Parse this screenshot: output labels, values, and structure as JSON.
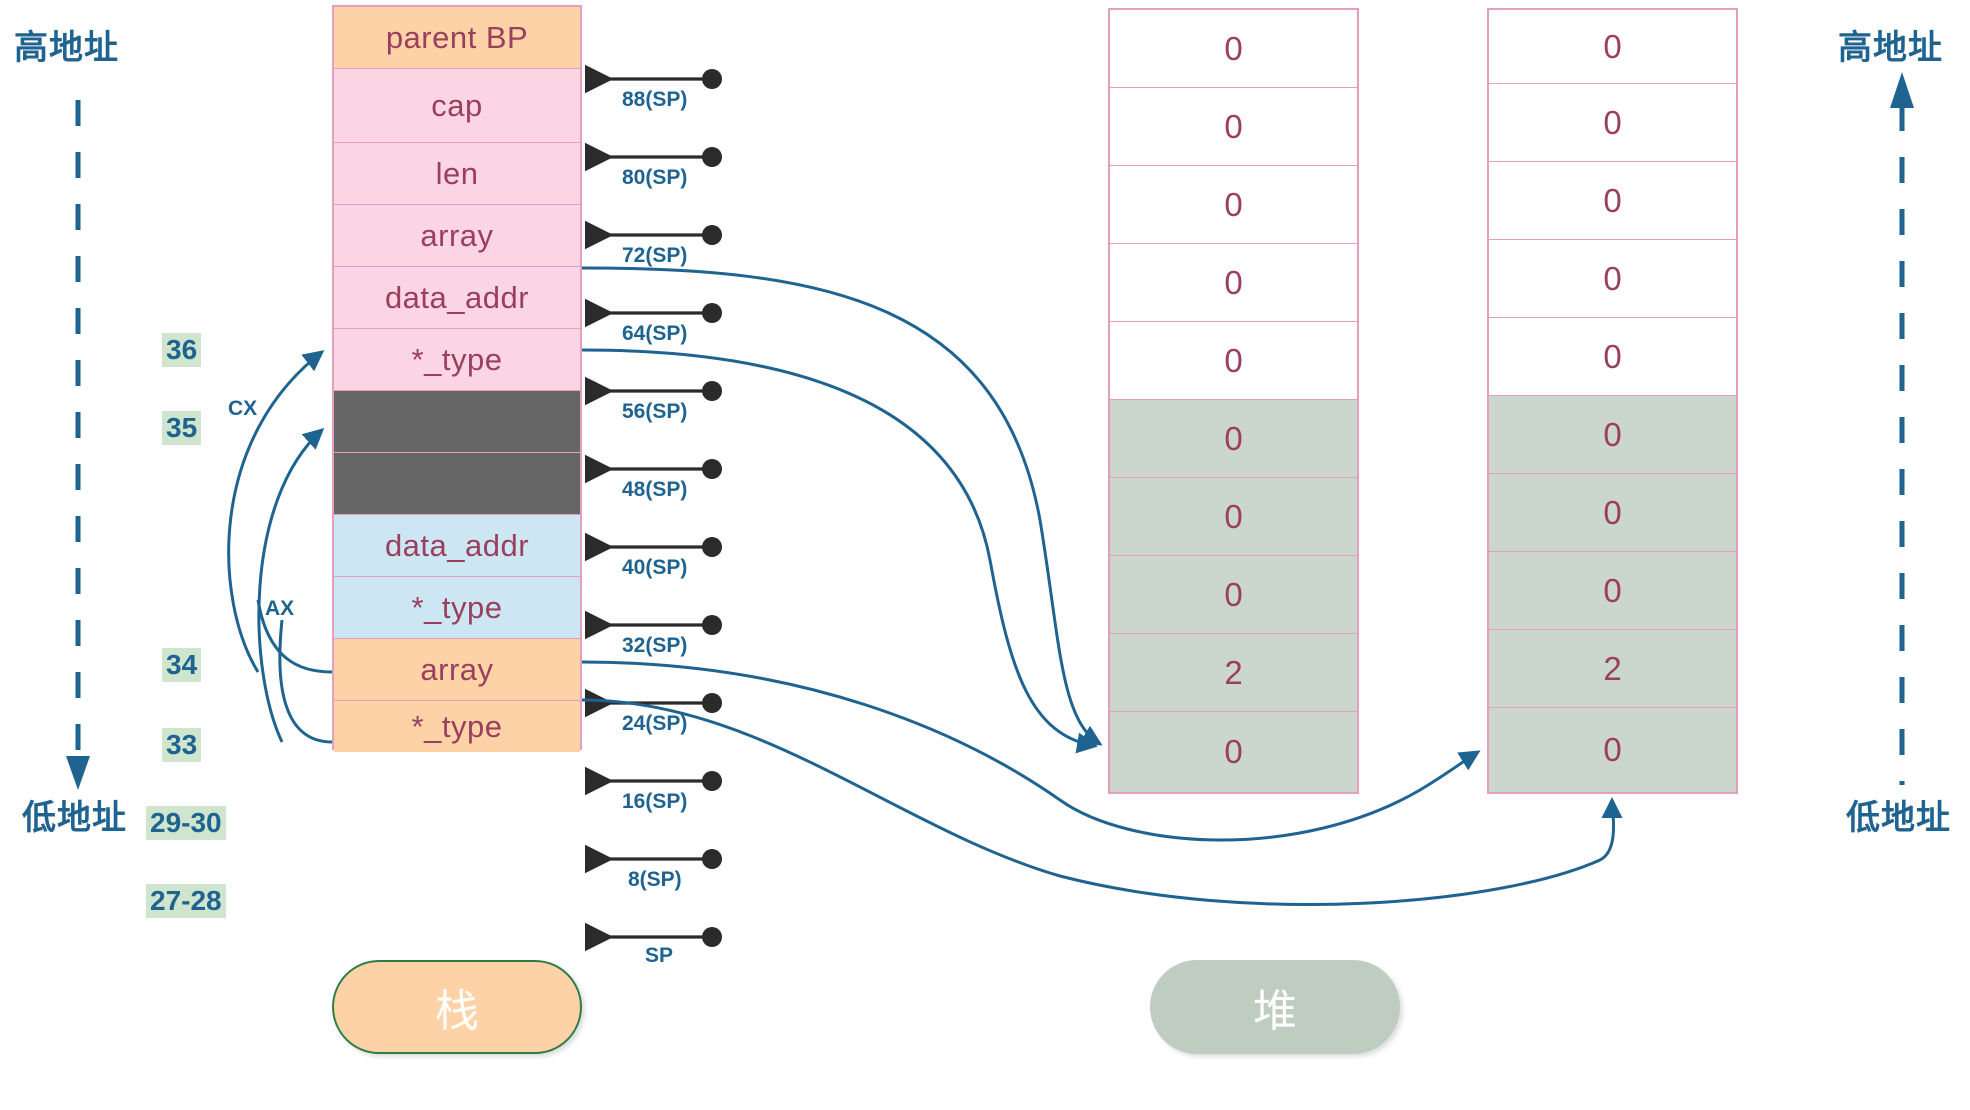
{
  "axes": {
    "left": {
      "high": "高地址",
      "low": "低地址"
    },
    "right": {
      "high": "高地址",
      "low": "低地址"
    }
  },
  "legend": {
    "stack": "栈",
    "heap": "堆"
  },
  "line_numbers": [
    {
      "label": "36"
    },
    {
      "label": "35"
    },
    {
      "label": "34"
    },
    {
      "label": "33"
    },
    {
      "label": "29-30"
    },
    {
      "label": "27-28"
    }
  ],
  "registers": [
    {
      "label": "CX"
    },
    {
      "label": "AX"
    }
  ],
  "stack": {
    "cells": [
      {
        "label": "parent BP",
        "color": "#fcd2a6",
        "kind": "orange"
      },
      {
        "label": "cap",
        "color": "#fbd5e3",
        "kind": "pink"
      },
      {
        "label": "len",
        "color": "#fbd5e3",
        "kind": "pink"
      },
      {
        "label": "array",
        "color": "#fbd5e3",
        "kind": "pink"
      },
      {
        "label": "data_addr",
        "color": "#fbd5e3",
        "kind": "pink"
      },
      {
        "label": "*_type",
        "color": "#fbd5e3",
        "kind": "pink"
      },
      {
        "label": "",
        "color": "#666666",
        "kind": "dark"
      },
      {
        "label": "",
        "color": "#666666",
        "kind": "dark"
      },
      {
        "label": "data_addr",
        "color": "#cce7f3",
        "kind": "blue"
      },
      {
        "label": "*_type",
        "color": "#cce7f3",
        "kind": "blue"
      },
      {
        "label": "array",
        "color": "#fcd2a6",
        "kind": "orange"
      },
      {
        "label": "*_type",
        "color": "#fcd2a6",
        "kind": "orange"
      }
    ],
    "sp_offsets": [
      "88(SP)",
      "80(SP)",
      "72(SP)",
      "64(SP)",
      "56(SP)",
      "48(SP)",
      "40(SP)",
      "32(SP)",
      "24(SP)",
      "16(SP)",
      "8(SP)",
      "SP"
    ]
  },
  "heap": {
    "columns": [
      {
        "cells": [
          {
            "value": "0",
            "allocated": false
          },
          {
            "value": "0",
            "allocated": false
          },
          {
            "value": "0",
            "allocated": false
          },
          {
            "value": "0",
            "allocated": false
          },
          {
            "value": "0",
            "allocated": false
          },
          {
            "value": "0",
            "allocated": true
          },
          {
            "value": "0",
            "allocated": true
          },
          {
            "value": "0",
            "allocated": true
          },
          {
            "value": "2",
            "allocated": true
          },
          {
            "value": "0",
            "allocated": true
          }
        ]
      },
      {
        "cells": [
          {
            "value": "0",
            "allocated": false
          },
          {
            "value": "0",
            "allocated": false
          },
          {
            "value": "0",
            "allocated": false
          },
          {
            "value": "0",
            "allocated": false
          },
          {
            "value": "0",
            "allocated": false
          },
          {
            "value": "0",
            "allocated": true
          },
          {
            "value": "0",
            "allocated": true
          },
          {
            "value": "0",
            "allocated": true
          },
          {
            "value": "2",
            "allocated": true
          },
          {
            "value": "0",
            "allocated": true
          }
        ]
      }
    ]
  },
  "colors": {
    "accent_blue": "#1f6391",
    "border_pink": "#e59fbe",
    "text_maroon": "#9b3f5e",
    "badge_green": "#cfe5cd",
    "alloc_gray": "#cbd6cc",
    "stack_orange": "#fcd2a6",
    "stack_pink": "#fbd5e3",
    "stack_blue": "#cce7f3",
    "stack_dark": "#666666",
    "arrow_black": "#2b2b2b"
  }
}
